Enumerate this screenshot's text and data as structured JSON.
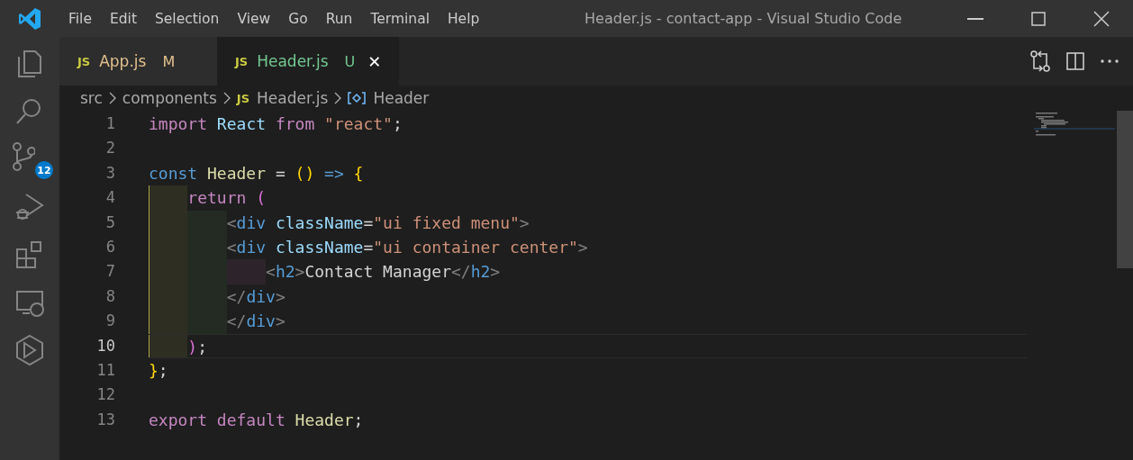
{
  "window": {
    "title": "Header.js - contact-app - Visual Studio Code"
  },
  "menu": [
    "File",
    "Edit",
    "Selection",
    "View",
    "Go",
    "Run",
    "Terminal",
    "Help"
  ],
  "activity_bar": [
    {
      "kind": "explorer"
    },
    {
      "kind": "search"
    },
    {
      "kind": "source-control",
      "badge": "12"
    },
    {
      "kind": "run-debug"
    },
    {
      "kind": "extensions"
    },
    {
      "kind": "remote"
    },
    {
      "kind": "deploy"
    }
  ],
  "tabs": [
    {
      "icon": "JS",
      "label": "App.js",
      "status": "M",
      "kind": "modified",
      "selected": false
    },
    {
      "icon": "JS",
      "label": "Header.js",
      "status": "U",
      "kind": "untracked",
      "selected": true,
      "close": "✕"
    }
  ],
  "breadcrumbs": [
    {
      "kind": "folder",
      "label": "src"
    },
    {
      "kind": "folder",
      "label": "components"
    },
    {
      "kind": "file",
      "icon": "JS",
      "label": "Header.js"
    },
    {
      "kind": "symbol",
      "label": "Header"
    }
  ],
  "editor": {
    "lines": [
      {
        "number": "1",
        "current": false,
        "tokens": [
          {
            "kind": "control",
            "text": "import"
          },
          {
            "kind": "variable",
            "text": " React"
          },
          {
            "kind": "control",
            "text": " from"
          },
          {
            "kind": "string",
            "text": " \"react\""
          },
          {
            "kind": "plain",
            "text": ";"
          }
        ]
      },
      {
        "number": "2",
        "current": false
      },
      {
        "number": "3",
        "current": false,
        "tokens": [
          {
            "kind": "keyword",
            "text": "const"
          },
          {
            "kind": "function",
            "text": " Header"
          },
          {
            "kind": "plain",
            "text": " ="
          },
          {
            "kind": "bracket1",
            "text": " ()"
          },
          {
            "kind": "keyword",
            "text": " =>"
          },
          {
            "kind": "bracket1",
            "text": " {"
          }
        ]
      },
      {
        "number": "4",
        "current": false,
        "tokens": [
          {
            "kind": "control",
            "text": "    return"
          },
          {
            "kind": "bracket2",
            "text": " ("
          }
        ]
      },
      {
        "number": "5",
        "current": false,
        "tokens": [
          {
            "kind": "tag-punct",
            "text": "        <"
          },
          {
            "kind": "keyword",
            "text": "div"
          },
          {
            "kind": "attribute",
            "text": " className"
          },
          {
            "kind": "plain",
            "text": "="
          },
          {
            "kind": "string",
            "text": "\"ui fixed menu\""
          },
          {
            "kind": "tag-punct",
            "text": ">"
          }
        ]
      },
      {
        "number": "6",
        "current": false,
        "tokens": [
          {
            "kind": "tag-punct",
            "text": "        <"
          },
          {
            "kind": "keyword",
            "text": "div"
          },
          {
            "kind": "attribute",
            "text": " className"
          },
          {
            "kind": "plain",
            "text": "="
          },
          {
            "kind": "string",
            "text": "\"ui container center\""
          },
          {
            "kind": "tag-punct",
            "text": ">"
          }
        ]
      },
      {
        "number": "7",
        "current": false,
        "tokens": [
          {
            "kind": "tag-punct",
            "text": "            <"
          },
          {
            "kind": "keyword",
            "text": "h2"
          },
          {
            "kind": "tag-punct",
            "text": ">"
          },
          {
            "kind": "plain",
            "text": "Contact Manager"
          },
          {
            "kind": "tag-punct",
            "text": "</"
          },
          {
            "kind": "keyword",
            "text": "h2"
          },
          {
            "kind": "tag-punct",
            "text": ">"
          }
        ]
      },
      {
        "number": "8",
        "current": false,
        "tokens": [
          {
            "kind": "tag-punct",
            "text": "        </"
          },
          {
            "kind": "keyword",
            "text": "div"
          },
          {
            "kind": "tag-punct",
            "text": ">"
          }
        ]
      },
      {
        "number": "9",
        "current": false,
        "tokens": [
          {
            "kind": "tag-punct",
            "text": "        </"
          },
          {
            "kind": "keyword",
            "text": "div"
          },
          {
            "kind": "tag-punct",
            "text": ">"
          }
        ]
      },
      {
        "number": "10",
        "current": true,
        "tokens": [
          {
            "kind": "bracket2",
            "text": "    )"
          },
          {
            "kind": "plain",
            "text": ";"
          }
        ]
      },
      {
        "number": "11",
        "current": false,
        "tokens": [
          {
            "kind": "bracket1",
            "text": "}"
          },
          {
            "kind": "plain",
            "text": ";"
          }
        ]
      },
      {
        "number": "12",
        "current": false
      },
      {
        "number": "13",
        "current": false,
        "tokens": [
          {
            "kind": "control",
            "text": "export default"
          },
          {
            "kind": "function",
            "text": " Header"
          },
          {
            "kind": "plain",
            "text": ";"
          }
        ]
      }
    ]
  }
}
